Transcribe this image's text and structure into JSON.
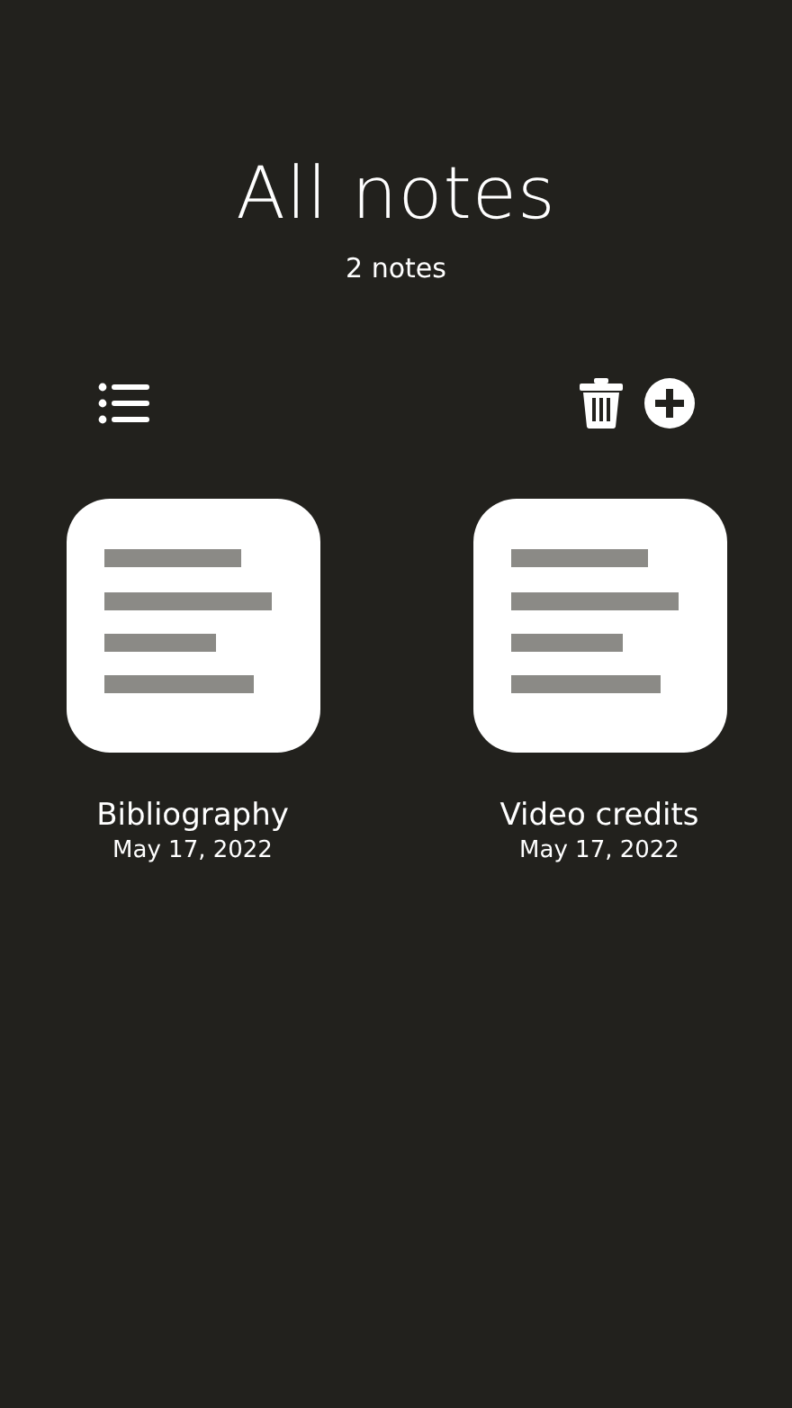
{
  "header": {
    "title": "All notes",
    "subtitle": "2 notes"
  },
  "notes": [
    {
      "title": "Bibliography",
      "date": "May 17, 2022"
    },
    {
      "title": "Video credits",
      "date": "May 17, 2022"
    }
  ]
}
